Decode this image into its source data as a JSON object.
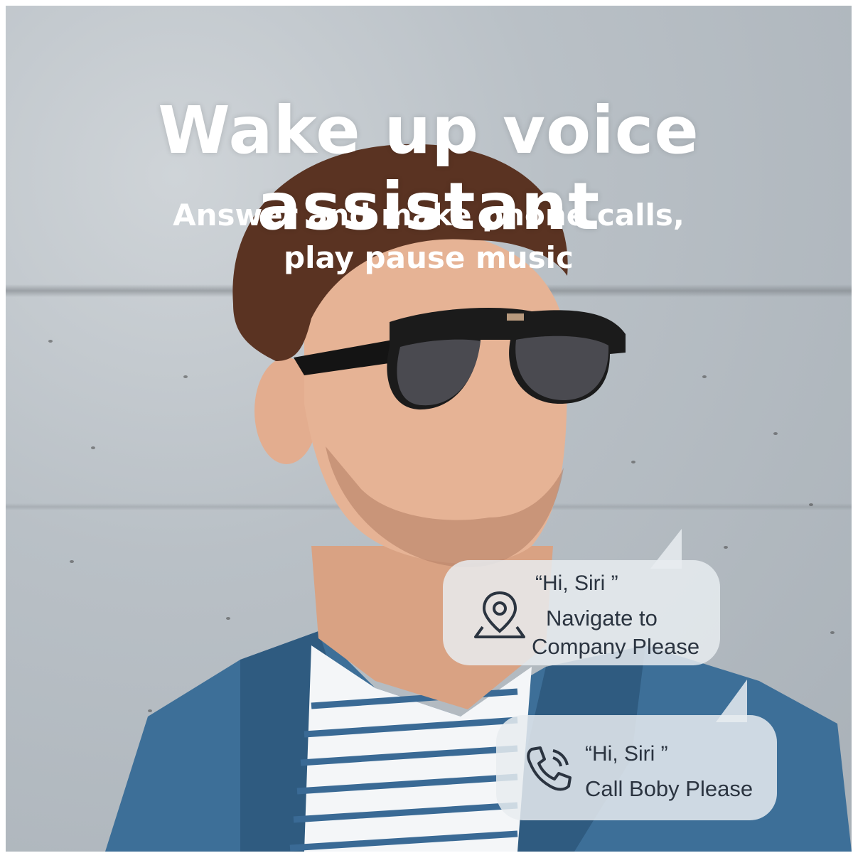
{
  "headline": "Wake up voice assistant",
  "subheadline": {
    "line1": "Answer and make phone calls,",
    "line2": "play pause music"
  },
  "bubbles": [
    {
      "icon": "location-pin-icon",
      "quote": "“Hi,  Siri ”",
      "line1": "Navigate to",
      "line2": "Company Please"
    },
    {
      "icon": "phone-call-icon",
      "quote": "“Hi,  Siri ”",
      "line1": "Call Boby Please"
    }
  ],
  "colors": {
    "text_white": "#ffffff",
    "bubble_text": "#2b3440",
    "jacket_blue": "#3d6f98"
  }
}
